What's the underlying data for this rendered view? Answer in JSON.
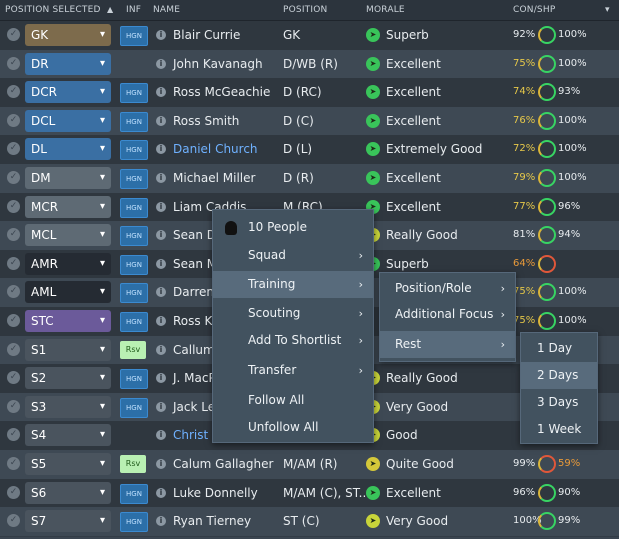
{
  "header": {
    "position_selected": "POSITION SELECTED",
    "sort_arrow": "▲",
    "inf": "INF",
    "name": "NAME",
    "position": "POSITION",
    "morale": "MORALE",
    "con_shp": "CON/SHP",
    "more": "▾"
  },
  "rows": [
    {
      "pos": "GK",
      "pos_color": "#7d6b4c",
      "inf": "HGN",
      "name": "Blair Currie",
      "name_link": false,
      "role": "GK",
      "morale": "Superb",
      "morale_color": "#39c45a",
      "con": "92%",
      "con_color": "#e8ecef",
      "ring_color": "#38d463",
      "shp": "100%",
      "shp_color": "#e8ecef"
    },
    {
      "pos": "DR",
      "pos_color": "#3a6fa3",
      "inf": "",
      "name": "John Kavanagh",
      "name_link": false,
      "role": "D/WB (R)",
      "morale": "Excellent",
      "morale_color": "#39c45a",
      "con": "75%",
      "con_color": "#e6c84a",
      "ring_color": "#38d463",
      "shp": "100%",
      "shp_color": "#e8ecef"
    },
    {
      "pos": "DCR",
      "pos_color": "#3a6fa3",
      "inf": "HGN",
      "name": "Ross McGeachie",
      "name_link": false,
      "role": "D (RC)",
      "morale": "Excellent",
      "morale_color": "#39c45a",
      "con": "74%",
      "con_color": "#e6c84a",
      "ring_color": "#38d463",
      "shp": "93%",
      "shp_color": "#e8ecef"
    },
    {
      "pos": "DCL",
      "pos_color": "#3a6fa3",
      "inf": "HGN",
      "name": "Ross Smith",
      "name_link": false,
      "role": "D (C)",
      "morale": "Excellent",
      "morale_color": "#39c45a",
      "con": "76%",
      "con_color": "#e6c84a",
      "ring_color": "#38d463",
      "shp": "100%",
      "shp_color": "#e8ecef"
    },
    {
      "pos": "DL",
      "pos_color": "#3a6fa3",
      "inf": "HGN",
      "name": "Daniel Church",
      "name_link": true,
      "role": "D (L)",
      "morale": "Extremely Good",
      "morale_color": "#39c45a",
      "con": "72%",
      "con_color": "#e6c84a",
      "ring_color": "#38d463",
      "shp": "100%",
      "shp_color": "#e8ecef"
    },
    {
      "pos": "DM",
      "pos_color": "#5e6a74",
      "inf": "HGN",
      "name": "Michael Miller",
      "name_link": false,
      "role": "D (R)",
      "morale": "Excellent",
      "morale_color": "#39c45a",
      "con": "79%",
      "con_color": "#e6c84a",
      "ring_color": "#38d463",
      "shp": "100%",
      "shp_color": "#e8ecef"
    },
    {
      "pos": "MCR",
      "pos_color": "#5e6a74",
      "inf": "HGN",
      "name": "Liam Caddis",
      "name_link": false,
      "role": "M (RC)",
      "morale": "Excellent",
      "morale_color": "#39c45a",
      "con": "77%",
      "con_color": "#e6c84a",
      "ring_color": "#38d463",
      "shp": "96%",
      "shp_color": "#e8ecef"
    },
    {
      "pos": "MCL",
      "pos_color": "#5e6a74",
      "inf": "HGN",
      "name": "Sean D",
      "name_link": false,
      "role": "",
      "morale": "Really Good",
      "morale_color": "#c8d43a",
      "con": "81%",
      "con_color": "#e8ecef",
      "ring_color": "#38d463",
      "shp": "94%",
      "shp_color": "#e8ecef"
    },
    {
      "pos": "AMR",
      "pos_color": "#252b33",
      "inf": "HGN",
      "name": "Sean M",
      "name_link": false,
      "role": "",
      "morale": "Superb",
      "morale_color": "#39c45a",
      "con": "64%",
      "con_color": "#e89a3a",
      "ring_color": "#e0573a",
      "shp": "",
      "shp_color": "#e8ecef"
    },
    {
      "pos": "AML",
      "pos_color": "#252b33",
      "inf": "HGN",
      "name": "Darren",
      "name_link": false,
      "role": "",
      "morale": "",
      "morale_color": "#39c45a",
      "con": "75%",
      "con_color": "#e6c84a",
      "ring_color": "#38d463",
      "shp": "100%",
      "shp_color": "#e8ecef"
    },
    {
      "pos": "STC",
      "pos_color": "#6b5a9a",
      "inf": "HGN",
      "name": "Ross Ka",
      "name_link": false,
      "role": "",
      "morale": "",
      "morale_color": "#39c45a",
      "con": "75%",
      "con_color": "#e6c84a",
      "ring_color": "#38d463",
      "shp": "100%",
      "shp_color": "#e8ecef"
    },
    {
      "pos": "S1",
      "pos_color": "#4a545e",
      "inf": "Rsv",
      "name": "Callum",
      "name_link": false,
      "role": "",
      "morale": "",
      "morale_color": "#39c45a",
      "con": "",
      "con_color": "#e8ecef",
      "ring_color": "",
      "shp": "",
      "shp_color": "#e8ecef"
    },
    {
      "pos": "S2",
      "pos_color": "#4a545e",
      "inf": "HGN",
      "name": "J. MacP",
      "name_link": false,
      "role": "",
      "morale": "Really Good",
      "morale_color": "#c8d43a",
      "con": "",
      "con_color": "#e8ecef",
      "ring_color": "",
      "shp": "",
      "shp_color": "#e8ecef"
    },
    {
      "pos": "S3",
      "pos_color": "#4a545e",
      "inf": "HGN",
      "name": "Jack Le",
      "name_link": false,
      "role": "",
      "morale": "Very Good",
      "morale_color": "#c8d43a",
      "con": "",
      "con_color": "#e8ecef",
      "ring_color": "",
      "shp": "",
      "shp_color": "#e8ecef"
    },
    {
      "pos": "S4",
      "pos_color": "#4a545e",
      "inf": "",
      "name": "Christ M",
      "name_link": true,
      "role": "",
      "morale": "Good",
      "morale_color": "#c8d43a",
      "con": "",
      "con_color": "#e8ecef",
      "ring_color": "",
      "shp": "",
      "shp_color": "#e8ecef"
    },
    {
      "pos": "S5",
      "pos_color": "#4a545e",
      "inf": "Rsv",
      "name": "Calum Gallagher",
      "name_link": false,
      "role": "M/AM (R)",
      "morale": "Quite Good",
      "morale_color": "#d4c83a",
      "con": "99%",
      "con_color": "#e8ecef",
      "ring_color": "#e0573a",
      "shp": "59%",
      "shp_color": "#e89a3a"
    },
    {
      "pos": "S6",
      "pos_color": "#4a545e",
      "inf": "HGN",
      "name": "Luke Donnelly",
      "name_link": false,
      "role": "M/AM (C), ST...",
      "morale": "Excellent",
      "morale_color": "#39c45a",
      "con": "96%",
      "con_color": "#e8ecef",
      "ring_color": "#38d463",
      "shp": "90%",
      "shp_color": "#e8ecef"
    },
    {
      "pos": "S7",
      "pos_color": "#4a545e",
      "inf": "HGN",
      "name": "Ryan Tierney",
      "name_link": false,
      "role": "ST (C)",
      "morale": "Very Good",
      "morale_color": "#c8d43a",
      "con": "100%",
      "con_color": "#e8ecef",
      "ring_color": "#38d463",
      "shp": "99%",
      "shp_color": "#e8ecef"
    }
  ],
  "context_menu": {
    "title": "10 People",
    "items": [
      {
        "label": "Squad",
        "submenu": true,
        "highlight": false
      },
      {
        "label": "Training",
        "submenu": true,
        "highlight": true
      },
      {
        "label": "Scouting",
        "submenu": true,
        "highlight": false
      },
      {
        "label": "Add To Shortlist",
        "submenu": true,
        "highlight": false
      },
      {
        "label": "Transfer",
        "submenu": true,
        "highlight": false
      },
      {
        "label": "Follow All",
        "submenu": false,
        "highlight": false
      },
      {
        "label": "Unfollow All",
        "submenu": false,
        "highlight": false
      }
    ]
  },
  "training_menu": {
    "items": [
      {
        "label": "Position/Role",
        "submenu": true,
        "highlight": false
      },
      {
        "label": "Additional Focus",
        "submenu": true,
        "highlight": false
      },
      {
        "label": "Rest",
        "submenu": true,
        "highlight": true
      }
    ]
  },
  "rest_menu": {
    "items": [
      {
        "label": "1 Day",
        "highlight": false
      },
      {
        "label": "2 Days",
        "highlight": true
      },
      {
        "label": "3 Days",
        "highlight": false
      },
      {
        "label": "1 Week",
        "highlight": false
      }
    ]
  },
  "glyphs": {
    "chevron_down": "⌄",
    "submenu_arrow": "›",
    "check": "✓",
    "info": "i",
    "morale_arrow": "➤"
  }
}
